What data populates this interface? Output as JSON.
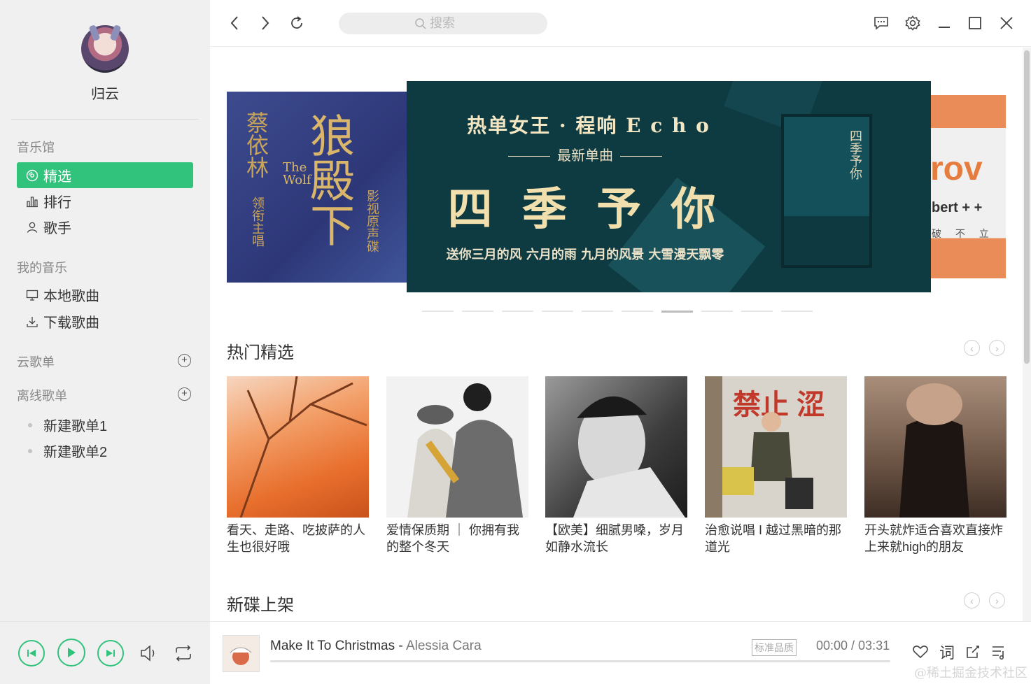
{
  "user": {
    "name": "归云"
  },
  "sidebar": {
    "music_hall": {
      "title": "音乐馆",
      "items": [
        {
          "label": "精选",
          "icon": "disc-icon",
          "active": true
        },
        {
          "label": "排行",
          "icon": "bar-chart-icon"
        },
        {
          "label": "歌手",
          "icon": "person-icon"
        }
      ]
    },
    "my_music": {
      "title": "我的音乐",
      "items": [
        {
          "label": "本地歌曲",
          "icon": "monitor-icon"
        },
        {
          "label": "下载歌曲",
          "icon": "download-icon"
        }
      ]
    },
    "cloud_playlists": {
      "title": "云歌单"
    },
    "offline_playlists": {
      "title": "离线歌单",
      "items": [
        "新建歌单1",
        "新建歌单2"
      ]
    }
  },
  "topbar": {
    "search_placeholder": "搜索"
  },
  "banners": {
    "left": {
      "artist": "蔡依林",
      "role": "领衔主唱",
      "title": "狼殿下",
      "latin": "The Wolf",
      "sub": "影视原声碟"
    },
    "main": {
      "title": "热单女王 · 程响 E c h o",
      "subtitle": "最新单曲",
      "song": "四 季 予 你",
      "desc": "送你三月的风 六月的雨 九月的风景 大雪漫天飘零",
      "poster_text": "四季予你"
    },
    "right": {
      "big": "rov",
      "line1": "bert +  +",
      "line2": "破 不 立"
    },
    "dot_count": 10,
    "active_dot": 6
  },
  "hot_picks": {
    "title": "热门精选",
    "items": [
      {
        "title": "看天、走路、吃披萨的人生也很好哦"
      },
      {
        "title": "爱情保质期 ｜ 你拥有我的整个冬天"
      },
      {
        "title": "【欧美】细腻男嗓，岁月如静水流长"
      },
      {
        "title": "治愈说唱 I 越过黑暗的那道光",
        "cover_text": "禁止 涩"
      },
      {
        "title": "开头就炸适合喜欢直接炸上来就high的朋友"
      }
    ]
  },
  "new_albums": {
    "title": "新碟上架"
  },
  "player": {
    "song": "Make It To Christmas",
    "separator": " - ",
    "artist": "Alessia Cara",
    "quality": "标准品质",
    "time": "00:00 / 03:31",
    "progress": 0,
    "lyrics_label": "词"
  },
  "watermark": "@稀土掘金技术社区",
  "colors": {
    "accent": "#31c27c",
    "banner_bg": "#0e3a42"
  }
}
